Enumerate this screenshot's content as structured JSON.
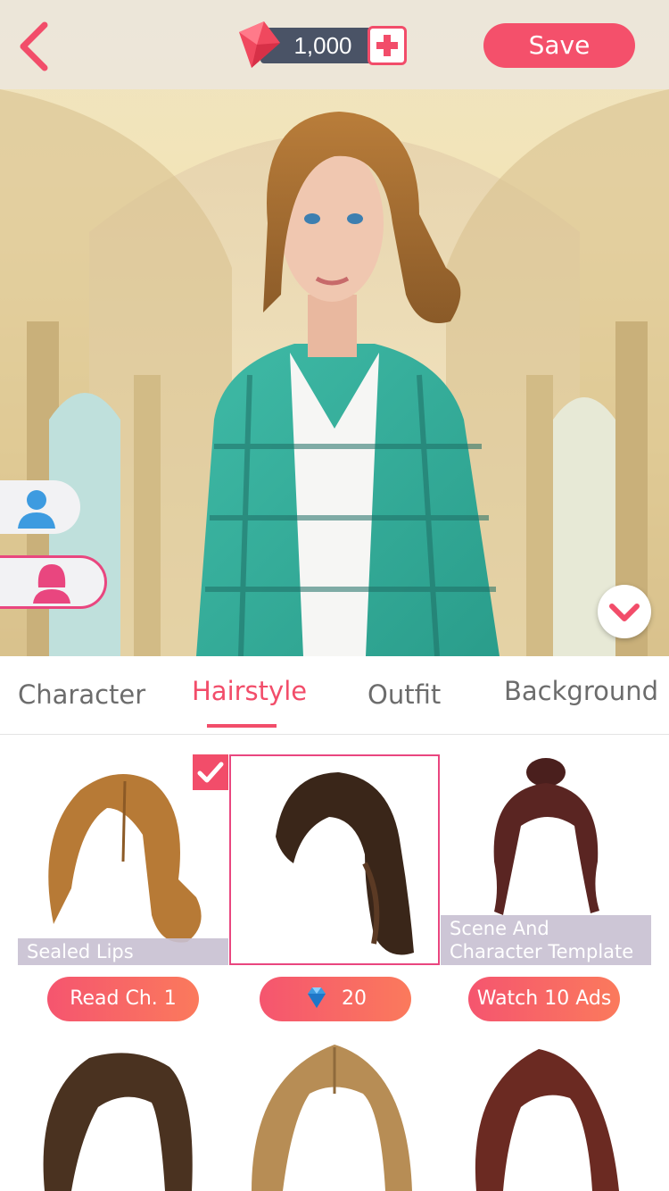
{
  "header": {
    "gem_count": "1,000",
    "save_label": "Save"
  },
  "tabs": [
    {
      "label": "Character",
      "active": false
    },
    {
      "label": "Hairstyle",
      "active": true
    },
    {
      "label": "Outfit",
      "active": false
    },
    {
      "label": "Background",
      "active": false
    }
  ],
  "hairstyles": [
    {
      "caption": "Sealed Lips",
      "unlock": "Read Ch. 1",
      "selected": false,
      "equipped": true
    },
    {
      "caption": "",
      "unlock": "20",
      "unlock_icon": "diamond-icon",
      "selected": true,
      "equipped": false
    },
    {
      "caption": "Scene And Character Template",
      "unlock": "Watch 10 Ads",
      "selected": false,
      "equipped": false
    }
  ],
  "colors": {
    "accent": "#f24d6a",
    "gem_pill": "#4a5366",
    "tab_inactive": "#6c6c6c"
  }
}
